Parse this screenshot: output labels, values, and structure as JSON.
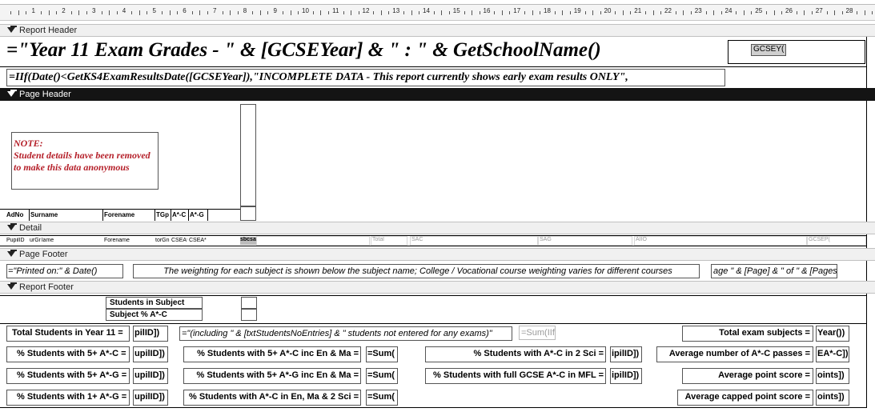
{
  "ruler": {
    "numbers": [
      "1",
      "2",
      "3",
      "4",
      "5",
      "6",
      "7",
      "8",
      "9",
      "10",
      "11",
      "12",
      "13",
      "14",
      "15",
      "16",
      "17",
      "18",
      "19",
      "20",
      "21",
      "22",
      "23",
      "24",
      "25",
      "26",
      "27",
      "28"
    ]
  },
  "sections": {
    "report_header": "Report Header",
    "page_header": "Page Header",
    "detail": "Detail",
    "page_footer": "Page Footer",
    "report_footer": "Report Footer"
  },
  "report_header": {
    "title": "=\"Year 11 Exam Grades  - \" & [GCSEYear] & \" :   \" & GetSchoolName()",
    "gcse_field": "GCSEY(",
    "incomplete_formula": "=IIf(Date()<GetKS4ExamResultsDate([GCSEYear]),\"INCOMPLETE DATA - This report currently shows early exam results ONLY\","
  },
  "page_header": {
    "note_title": "NOTE:",
    "note_line1": "Student details have been removed",
    "note_line2": "to make this data anonymous",
    "columns": {
      "adno": "AdNo",
      "surname": "Surname",
      "forename": "Forename",
      "tgp": "TGp",
      "ac": "A*-C",
      "ag": "A*-G"
    }
  },
  "detail": {
    "pupil_id": "PupilID",
    "surname": "urGn",
    "name": "lame",
    "forename": "Forename",
    "tutor_group": "torGn",
    "gcse_ac": "CSEA*",
    "gcse_ag": "CSEA*",
    "subj": "sbcsa",
    "total": "Total",
    "sac": "SAC",
    "sag": "SAG",
    "aio": "AIIO",
    "gcsep": "GCSEP("
  },
  "page_footer": {
    "printed_on": "=\"Printed on:\" & Date()",
    "weighting_note": "The weighting for each subject is shown below the subject name; College / Vocational course weighting varies for different courses",
    "page_formula": "age \" & [Page] & \" of \" & [Pages]"
  },
  "report_footer": {
    "students_in_subject": "Students in Subject",
    "subject_pct_ac": "Subject % A*-C",
    "total_students_label": "Total Students in Year 11 =",
    "total_students_value": "pilID])",
    "including_formula": "=\"(including \" & [txtStudentsNoEntries] & \" students not entered for any exams)\"",
    "sum_iif": "=Sum(IIf(",
    "total_exam_subjects_label": "Total exam subjects =",
    "total_exam_subjects_value": "Year())",
    "pct_5ac_label": "% Students with 5+ A*-C =",
    "pct_5ac_value": "upilID])",
    "pct_5ac_enma_label": "% Students with 5+ A*-C inc En & Ma =",
    "pct_5ac_enma_value": "=Sum(",
    "pct_ac_2sci_label": "% Students with A*-C in 2 Sci =",
    "pct_ac_2sci_value": "ipilID])",
    "avg_ac_passes_label": "Average number of A*-C passes =",
    "avg_ac_passes_value": "EA*-C])",
    "pct_5ag_label": "% Students with 5+ A*-G =",
    "pct_5ag_value": "upilID])",
    "pct_5ag_enma_label": "% Students with 5+ A*-G inc En & Ma =",
    "pct_5ag_enma_value": "=Sum(",
    "pct_full_gcse_mfl_label": "% Students with full GCSE A*-C in MFL =",
    "pct_full_gcse_mfl_value": "ipilID])",
    "avg_point_label": "Average point score =",
    "avg_point_value": "oints])",
    "pct_1ag_label": "% Students with 1+ A*-G =",
    "pct_1ag_value": "upilID])",
    "pct_ac_enma2sci_label": "% Students with A*-C in En, Ma & 2 Sci =",
    "pct_ac_enma2sci_value": "=Sum(",
    "avg_capped_label": "Average capped point score =",
    "avg_capped_value": "oints])"
  }
}
